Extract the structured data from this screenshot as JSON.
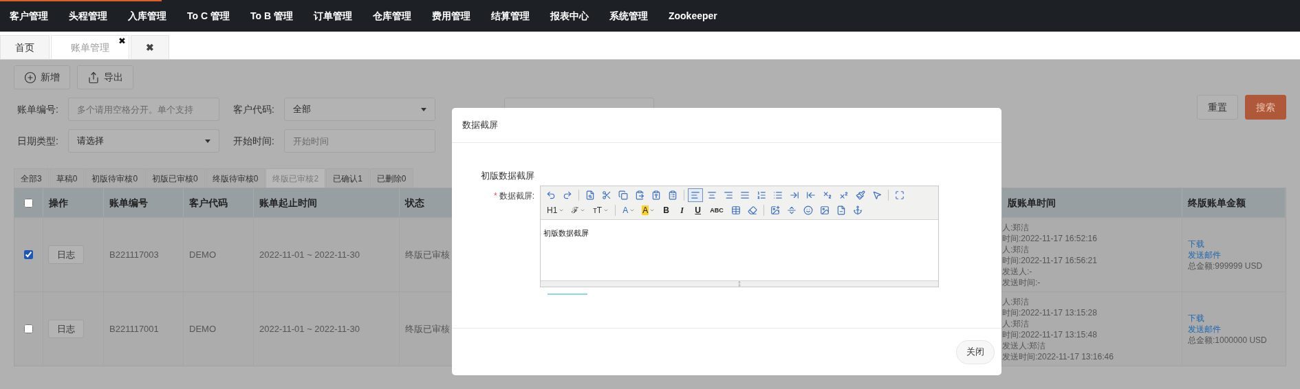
{
  "nav": {
    "items": [
      "客户管理",
      "头程管理",
      "入库管理",
      "To C 管理",
      "To B 管理",
      "订单管理",
      "仓库管理",
      "费用管理",
      "结算管理",
      "报表中心",
      "系统管理",
      "Zookeeper"
    ]
  },
  "page_tabs": [
    {
      "label": "首页",
      "selected": false
    },
    {
      "label": "账单管理",
      "selected": true,
      "close": "✖"
    },
    {
      "label": "✖",
      "selected": false
    }
  ],
  "toolbar": [
    {
      "label": "新增"
    },
    {
      "label": "导出"
    }
  ],
  "filters": [
    [
      {
        "kind": "input",
        "label": "账单编号:",
        "placeholder": "多个请用空格分开。单个支持"
      },
      {
        "kind": "select",
        "label": "客户代码:",
        "value": "全部"
      },
      {
        "kind": "covered"
      }
    ],
    [
      {
        "kind": "select",
        "label": "日期类型:",
        "value": "请选择"
      },
      {
        "kind": "input",
        "label": "开始时间:",
        "placeholder": "开始时间"
      }
    ]
  ],
  "filter_buttons": [
    {
      "kind": "default",
      "label": "重置"
    },
    {
      "kind": "primary",
      "label": "搜索"
    }
  ],
  "status_tabs": [
    {
      "label": "全部3",
      "selected": false
    },
    {
      "label": "草稿0",
      "selected": false
    },
    {
      "label": "初版待审核0",
      "selected": false
    },
    {
      "label": "初版已审核0",
      "selected": false
    },
    {
      "label": "终版待审核0",
      "selected": false
    },
    {
      "label": "终版已审核2",
      "selected": true
    },
    {
      "label": "已确认1",
      "selected": false
    },
    {
      "label": "已删除0",
      "selected": false
    }
  ],
  "table": {
    "select_all": false,
    "columns": [
      "操作",
      "账单编号",
      "客户代码",
      "账单起止时间",
      "状态",
      "版账单时间",
      "终版账单金额"
    ],
    "rows": [
      {
        "selected": true,
        "action": "日志",
        "bill_no": "B221117003",
        "customer": "DEMO",
        "period": "2022-11-01 ~ 2022-11-30",
        "status": "终版已审核",
        "time_lines": [
          "人:郑洁",
          "时间:2022-11-17 16:52:16",
          "人:郑洁",
          "时间:2022-11-17 16:56:21",
          "发送人:-",
          "发送时间:-"
        ],
        "links": [
          "下载",
          "发送邮件"
        ],
        "total": "总金额:999999 USD"
      },
      {
        "selected": false,
        "action": "日志",
        "bill_no": "B221117001",
        "customer": "DEMO",
        "period": "2022-11-01 ~ 2022-11-30",
        "status": "终版已审核",
        "time_lines": [
          "人:郑洁",
          "时间:2022-11-17 13:15:28",
          "人:郑洁",
          "时间:2022-11-17 13:15:48",
          "发送人:郑洁",
          "发送时间:2022-11-17 13:16:46"
        ],
        "links": [
          "下载",
          "发送邮件"
        ],
        "total": "总金额:1000000 USD"
      }
    ]
  },
  "dialog": {
    "title": "数据截屏",
    "section_title": "初版数据截屏",
    "required_mark": "*",
    "field_label": "数据截屏:",
    "editor": {
      "toolbar_rows": [
        [
          {
            "kind": "icon",
            "selected": false
          },
          {
            "kind": "icon",
            "selected": false
          },
          {
            "kind": "separator"
          },
          {
            "kind": "icon",
            "selected": false
          },
          {
            "kind": "icon",
            "selected": false
          },
          {
            "kind": "icon",
            "selected": false
          },
          {
            "kind": "icon",
            "selected": false
          },
          {
            "kind": "icon",
            "selected": false
          },
          {
            "kind": "icon",
            "selected": false
          },
          {
            "kind": "separator"
          },
          {
            "kind": "icon",
            "selected": true
          },
          {
            "kind": "icon",
            "selected": false
          },
          {
            "kind": "icon",
            "selected": false
          },
          {
            "kind": "icon",
            "selected": false
          },
          {
            "kind": "icon",
            "selected": false
          },
          {
            "kind": "icon",
            "selected": false
          },
          {
            "kind": "icon",
            "selected": false
          },
          {
            "kind": "icon",
            "selected": false
          },
          {
            "kind": "icon",
            "selected": false
          },
          {
            "kind": "icon",
            "selected": false
          },
          {
            "kind": "icon",
            "selected": false
          },
          {
            "kind": "icon",
            "selected": false
          },
          {
            "kind": "separator"
          },
          {
            "kind": "icon",
            "selected": false
          }
        ],
        [
          {
            "kind": "dropdown",
            "label": "H1",
            "selected": false
          },
          {
            "kind": "dropdown",
            "label": "ℱ",
            "selected": false
          },
          {
            "kind": "dropdown",
            "label": "тT",
            "selected": false
          },
          {
            "kind": "separator"
          },
          {
            "kind": "font-color",
            "label": "A",
            "selected": false
          },
          {
            "kind": "highlight",
            "label": "A",
            "selected": false
          },
          {
            "kind": "bold",
            "label": "B",
            "selected": false
          },
          {
            "kind": "italic",
            "label": "I",
            "selected": false
          },
          {
            "kind": "underline",
            "label": "U",
            "selected": false
          },
          {
            "kind": "small",
            "label": "ABC",
            "selected": false
          },
          {
            "kind": "icon",
            "selected": false
          },
          {
            "kind": "icon",
            "selected": false
          },
          {
            "kind": "separator"
          },
          {
            "kind": "icon",
            "selected": false
          },
          {
            "kind": "icon",
            "selected": false
          },
          {
            "kind": "icon",
            "selected": false
          },
          {
            "kind": "icon",
            "selected": false
          },
          {
            "kind": "icon",
            "selected": false
          },
          {
            "kind": "icon",
            "selected": false
          }
        ]
      ],
      "content": "初版数据截屏"
    },
    "buttons": [
      "关闭"
    ]
  }
}
